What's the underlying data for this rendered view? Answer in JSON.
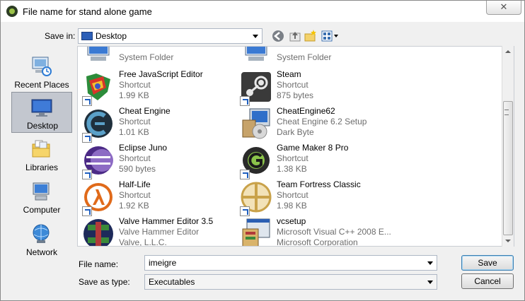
{
  "window": {
    "title": "File name for stand alone game",
    "close_glyph": "✕"
  },
  "toolbar": {
    "save_in_label": "Save in:",
    "save_in_value": "Desktop",
    "icons": [
      "back-icon",
      "up-folder-icon",
      "new-folder-icon",
      "view-menu-icon"
    ]
  },
  "places": [
    {
      "label": "Recent Places",
      "icon": "recent-places-icon"
    },
    {
      "label": "Desktop",
      "icon": "desktop-icon",
      "selected": true
    },
    {
      "label": "Libraries",
      "icon": "libraries-icon"
    },
    {
      "label": "Computer",
      "icon": "computer-icon"
    },
    {
      "label": "Network",
      "icon": "network-icon"
    }
  ],
  "files": [
    {
      "name": "",
      "line1": "System Folder",
      "line2": "",
      "icon": "system-folder-icon"
    },
    {
      "name": "",
      "line1": "System Folder",
      "line2": "",
      "icon": "system-folder-icon"
    },
    {
      "name": "Free JavaScript Editor",
      "line1": "Shortcut",
      "line2": "1.99 KB",
      "icon": "javascript-editor-icon"
    },
    {
      "name": "Steam",
      "line1": "Shortcut",
      "line2": "875 bytes",
      "icon": "steam-icon"
    },
    {
      "name": "Cheat Engine",
      "line1": "Shortcut",
      "line2": "1.01 KB",
      "icon": "cheat-engine-icon"
    },
    {
      "name": "CheatEngine62",
      "line1": "Cheat Engine 6.2 Setup",
      "line2": "Dark Byte",
      "icon": "installer-icon"
    },
    {
      "name": "Eclipse Juno",
      "line1": "Shortcut",
      "line2": "590 bytes",
      "icon": "eclipse-icon"
    },
    {
      "name": "Game Maker 8 Pro",
      "line1": "Shortcut",
      "line2": "1.38 KB",
      "icon": "game-maker-icon"
    },
    {
      "name": "Half-Life",
      "line1": "Shortcut",
      "line2": "1.92 KB",
      "icon": "half-life-icon"
    },
    {
      "name": "Team Fortress Classic",
      "line1": "Shortcut",
      "line2": "1.98 KB",
      "icon": "team-fortress-icon"
    },
    {
      "name": "Valve Hammer Editor 3.5",
      "line1": "Valve Hammer Editor",
      "line2": "Valve, L.L.C.",
      "icon": "hammer-editor-icon"
    },
    {
      "name": "vcsetup",
      "line1": "Microsoft Visual C++ 2008 E...",
      "line2": "Microsoft Corporation",
      "icon": "vcsetup-icon"
    }
  ],
  "form": {
    "file_name_label": "File name:",
    "file_name_value": "imeigre",
    "save_type_label": "Save as type:",
    "save_type_value": "Executables"
  },
  "buttons": {
    "save": "Save",
    "cancel": "Cancel"
  }
}
